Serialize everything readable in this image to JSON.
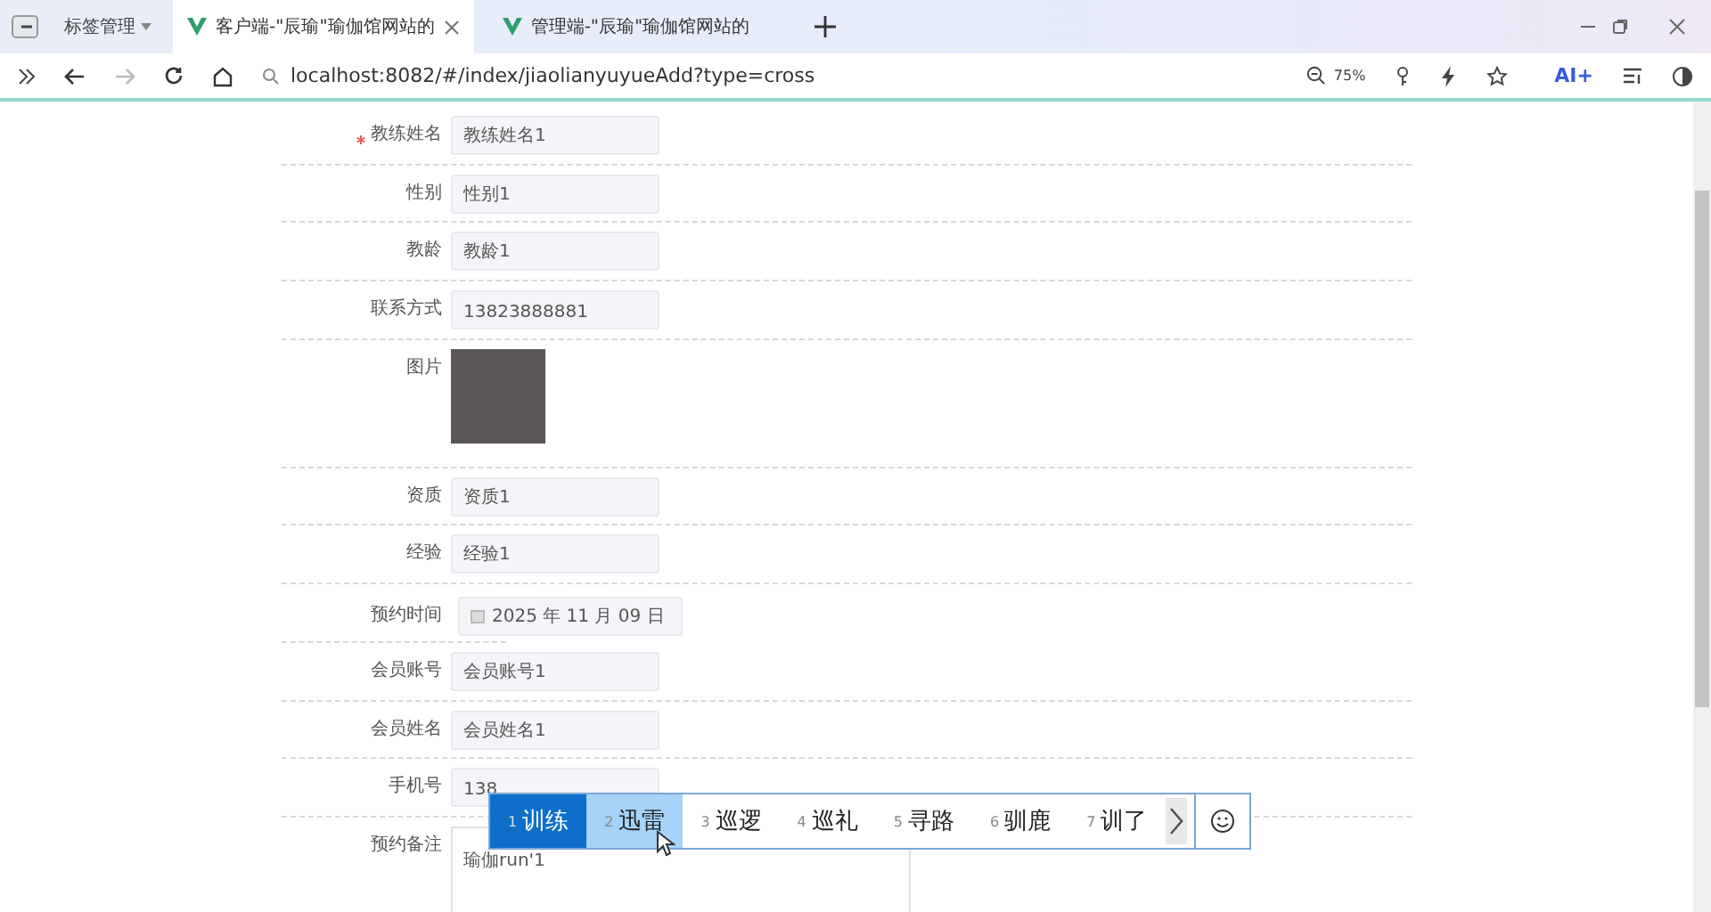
{
  "browser": {
    "group_label": "标签管理",
    "tabs": [
      {
        "title": "客户端-\"辰瑜\"瑜伽馆网站的",
        "selected": true
      },
      {
        "title": "管理端-\"辰瑜\"瑜伽馆网站的",
        "selected": false
      }
    ],
    "url": "localhost:8082/#/index/jiaolianyuyueAdd?type=cross",
    "zoom": "75%",
    "ai_label": "AI+"
  },
  "form": {
    "fields": [
      {
        "kind": "input",
        "label": "教练姓名",
        "required": true,
        "value": "教练姓名1"
      },
      {
        "kind": "input",
        "label": "性别",
        "required": false,
        "value": "性别1"
      },
      {
        "kind": "input",
        "label": "教龄",
        "required": false,
        "value": "教龄1"
      },
      {
        "kind": "input",
        "label": "联系方式",
        "required": false,
        "value": "13823888881"
      },
      {
        "kind": "image",
        "label": "图片",
        "required": false
      },
      {
        "kind": "input",
        "label": "资质",
        "required": false,
        "value": "资质1"
      },
      {
        "kind": "input",
        "label": "经验",
        "required": false,
        "value": "经验1"
      },
      {
        "kind": "date",
        "label": "预约时间",
        "required": false,
        "value": "2025 年 11 月 09 日"
      },
      {
        "kind": "input",
        "label": "会员账号",
        "required": false,
        "value": "会员账号1"
      },
      {
        "kind": "input",
        "label": "会员姓名",
        "required": false,
        "value": "会员姓名1"
      },
      {
        "kind": "input",
        "label": "手机号",
        "required": false,
        "value": "138"
      },
      {
        "kind": "textarea",
        "label": "预约备注",
        "required": false,
        "value": "瑜伽run'1"
      }
    ]
  },
  "ime": {
    "candidates": [
      {
        "number": "1",
        "text": "训练",
        "selected": true,
        "hovered": false
      },
      {
        "number": "2",
        "text": "迅雷",
        "selected": false,
        "hovered": true
      },
      {
        "number": "3",
        "text": "巡逻",
        "selected": false,
        "hovered": false
      },
      {
        "number": "4",
        "text": "巡礼",
        "selected": false,
        "hovered": false
      },
      {
        "number": "5",
        "text": "寻路",
        "selected": false,
        "hovered": false
      },
      {
        "number": "6",
        "text": "驯鹿",
        "selected": false,
        "hovered": false
      },
      {
        "number": "7",
        "text": "训了",
        "selected": false,
        "hovered": false
      }
    ]
  }
}
